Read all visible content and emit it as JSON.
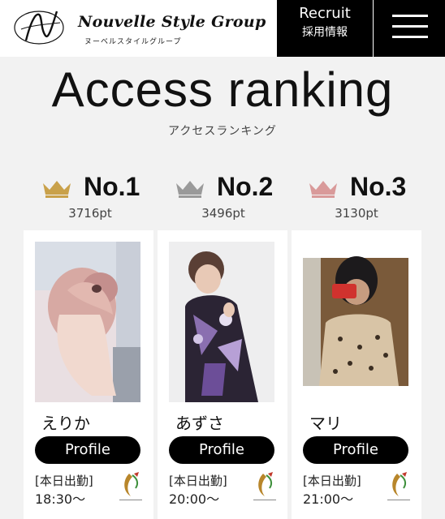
{
  "header": {
    "logo_name": "Nouvelle Style Group",
    "logo_sub": "ヌーベルスタイルグループ",
    "recruit_en": "Recruit",
    "recruit_ja": "採用情報",
    "menu_icon": "hamburger-menu-icon"
  },
  "ranking": {
    "title": "Access ranking",
    "subtitle": "アクセスランキング",
    "ranks": [
      {
        "label": "No.1",
        "points": "3716pt",
        "crown_color": "#c9a14a"
      },
      {
        "label": "No.2",
        "points": "3496pt",
        "crown_color": "#9a9a9a"
      },
      {
        "label": "No.3",
        "points": "3130pt",
        "crown_color": "#d99a9a"
      }
    ]
  },
  "cards": [
    {
      "name": "えりか",
      "button": "Profile",
      "shift_label": "[本日出勤]",
      "shift_time": "18:30〜",
      "store_logo": "CAPITAL"
    },
    {
      "name": "あずさ",
      "button": "Profile",
      "shift_label": "[本日出勤]",
      "shift_time": "20:00〜",
      "store_logo": "CAPITAL"
    },
    {
      "name": "マリ",
      "button": "Profile",
      "shift_label": "[本日出勤]",
      "shift_time": "21:00〜",
      "store_logo": "CAPITAL"
    }
  ]
}
